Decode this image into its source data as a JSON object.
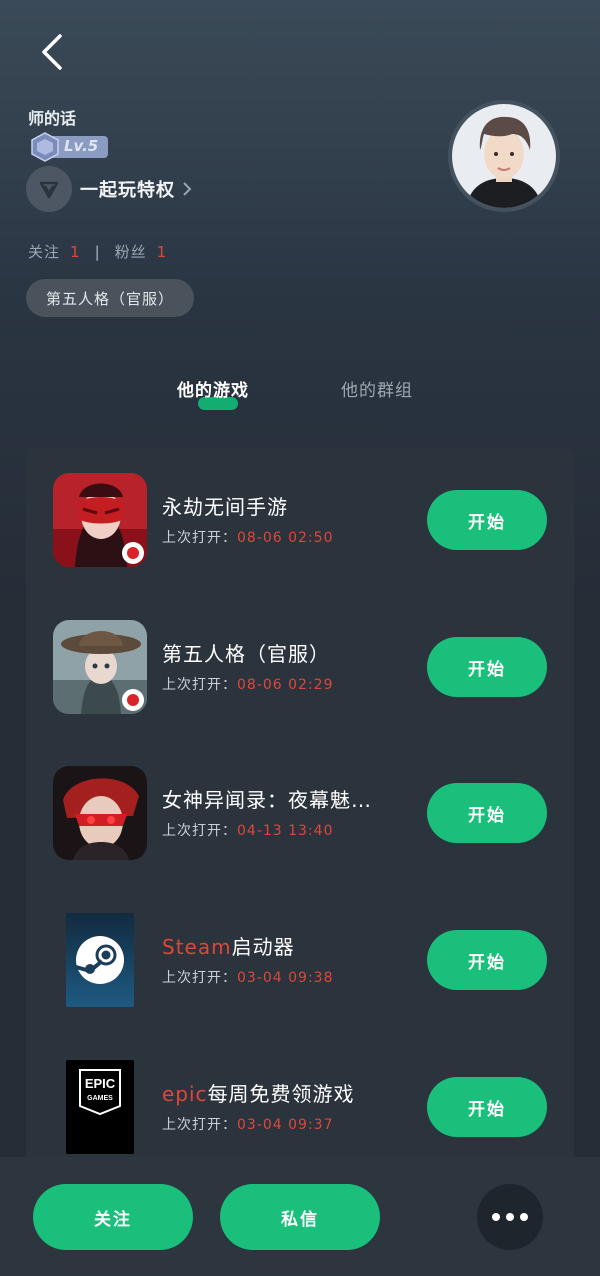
{
  "header": {
    "username": "师的话",
    "level": "Lv.5",
    "privilege_label": "一起玩特权",
    "icons": [
      "back-icon",
      "level-badge-icon",
      "privilege-icon",
      "chevron-right-icon"
    ]
  },
  "stats": {
    "following_label": "关注",
    "following_count": "1",
    "separator": "|",
    "fans_label": "粉丝",
    "fans_count": "1"
  },
  "tag": "第五人格（官服）",
  "tabs": [
    {
      "label": "他的游戏",
      "active": true
    },
    {
      "label": "他的群组",
      "active": false
    }
  ],
  "games": [
    {
      "name": "永劫无间手游",
      "name_highlight": "",
      "last_open_label": "上次打开：",
      "last_open_time": "08-06 02:50",
      "button": "开始",
      "icon": "naraka-game-icon"
    },
    {
      "name": "第五人格（官服）",
      "name_highlight": "",
      "last_open_label": "上次打开：",
      "last_open_time": "08-06 02:29",
      "button": "开始",
      "icon": "identity-v-game-icon"
    },
    {
      "name": "女神异闻录：夜幕魅…",
      "name_highlight": "",
      "last_open_label": "上次打开：",
      "last_open_time": "04-13 13:40",
      "button": "开始",
      "icon": "persona-game-icon"
    },
    {
      "name": "启动器",
      "name_highlight": "Steam",
      "last_open_label": "上次打开：",
      "last_open_time": "03-04 09:38",
      "button": "开始",
      "icon": "steam-icon"
    },
    {
      "name": "每周免费领游戏",
      "name_highlight": "epic",
      "last_open_label": "上次打开：",
      "last_open_time": "03-04 09:37",
      "button": "开始",
      "icon": "epic-games-icon"
    }
  ],
  "epic_logo_text": {
    "line1": "EPIC",
    "line2": "GAMES"
  },
  "bottom_bar": {
    "follow": "关注",
    "message": "私信",
    "more_icon": "more-icon"
  },
  "colors": {
    "accent": "#19bf7a",
    "highlight": "#e0463a",
    "card": "#2b333d"
  }
}
